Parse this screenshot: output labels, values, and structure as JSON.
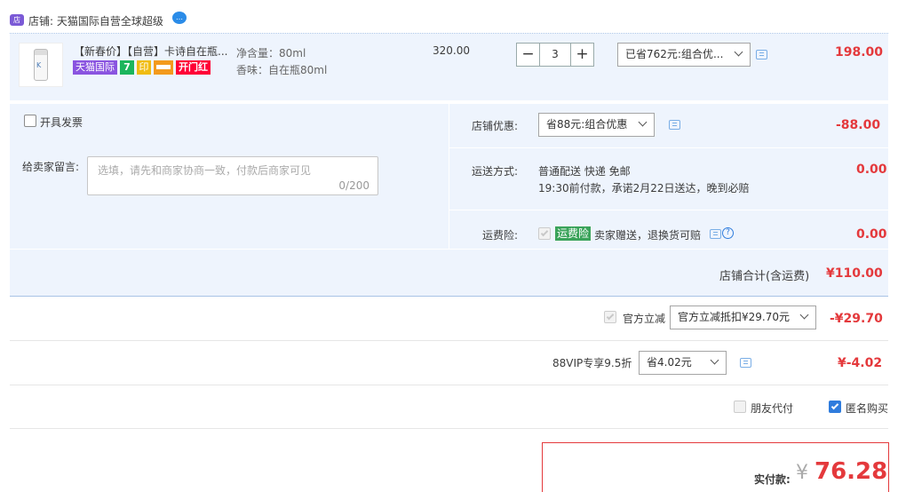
{
  "shop": {
    "icon": "shop-icon",
    "label": "店铺:",
    "name": "天猫国际自营全球超级",
    "chat_icon": "chat-bubble-icon"
  },
  "item": {
    "title": "【新春价】【自营】卡诗自在瓶...",
    "tags": [
      "天猫国际",
      "7",
      "印",
      "",
      "开门红"
    ],
    "spec_volume": "净含量：80ml",
    "spec_scent": "香味：自在瓶80ml",
    "unit_price": "320.00",
    "quantity": "3",
    "minus": "−",
    "plus": "+",
    "promo_select": "已省762元:组合优...",
    "subtotal": "198.00"
  },
  "invoice": {
    "label": "开具发票"
  },
  "message": {
    "label": "给卖家留言:",
    "placeholder": "选填，请先和商家协商一致，付款后商家可见",
    "counter": "0/200"
  },
  "shop_discount": {
    "label": "店铺优惠:",
    "select": "省88元:组合优惠",
    "amount": "-88.00"
  },
  "shipping": {
    "label": "运送方式:",
    "method": "普通配送 快递 免邮",
    "promise": "19:30前付款，承诺2月22日送达，晚到必赔",
    "amount": "0.00"
  },
  "insurance": {
    "label": "运费险:",
    "badge": "运费险",
    "desc": "卖家赠送，退换货可赔",
    "help": "?",
    "amount": "0.00"
  },
  "shop_total": {
    "label": "店铺合计(含运费)",
    "amount": "¥110.00"
  },
  "official": {
    "label": "官方立减",
    "select": "官方立减抵扣¥29.70元",
    "amount": "-¥29.70"
  },
  "vip": {
    "label": "88VIP专享9.5折",
    "select": "省4.02元",
    "amount": "¥-4.02"
  },
  "options": {
    "friend_pay": "朋友代付",
    "anonymous": "匿名购买"
  },
  "payment": {
    "label": "实付款:",
    "currency": "¥",
    "amount": "76.28"
  },
  "colors": {
    "price_red": "#e4393c",
    "panel_bg": "#eef4fd",
    "accent_blue": "#2f7cdd"
  }
}
